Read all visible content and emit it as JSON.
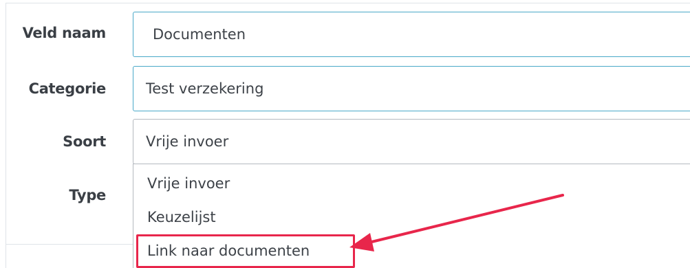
{
  "form": {
    "field_name": {
      "label": "Veld naam",
      "value": "Documenten"
    },
    "category": {
      "label": "Categorie",
      "value": "Test verzekering"
    },
    "kind": {
      "label": "Soort",
      "value": "Vrije invoer",
      "options": [
        "Vrije invoer",
        "Keuzelijst",
        "Link naar documenten"
      ]
    },
    "type": {
      "label": "Type"
    }
  },
  "annotation": {
    "highlight_color": "#e8264b",
    "highlighted_option": "Link naar documenten"
  },
  "colors": {
    "focus_border": "#48a8c8",
    "label_text": "#3a3f45",
    "input_text": "#3d4248"
  }
}
